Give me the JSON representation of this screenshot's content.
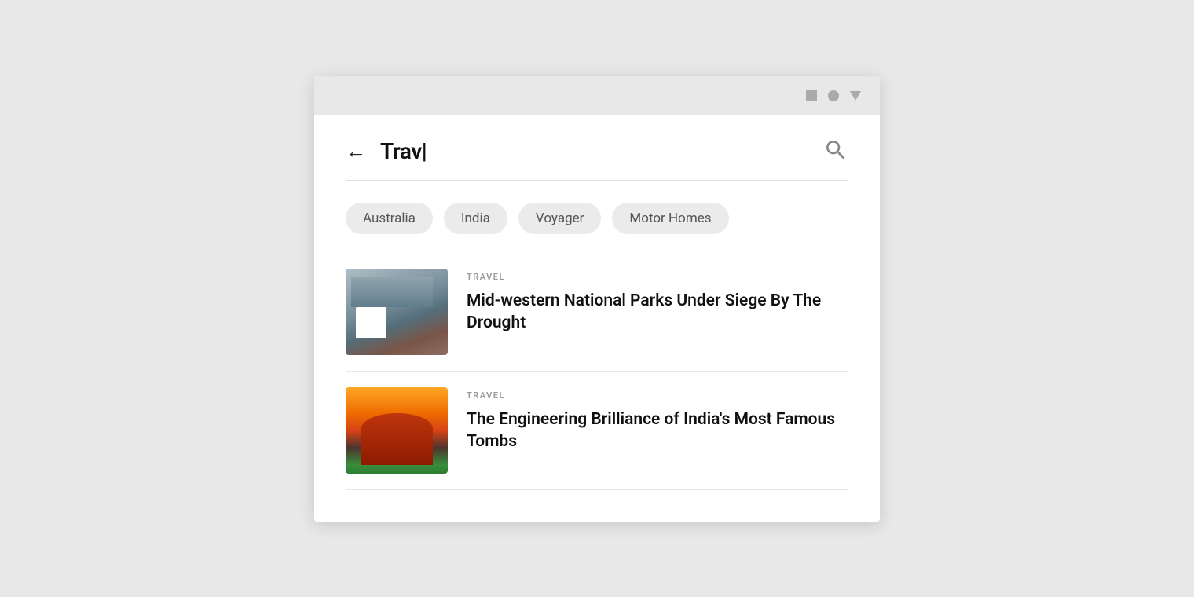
{
  "titlebar": {
    "icons": [
      "square",
      "circle",
      "triangle"
    ]
  },
  "search": {
    "back_label": "←",
    "query": "Trav|",
    "search_aria": "Search"
  },
  "tags": [
    {
      "label": "Australia",
      "id": "tag-australia"
    },
    {
      "label": "India",
      "id": "tag-india"
    },
    {
      "label": "Voyager",
      "id": "tag-voyager"
    },
    {
      "label": "Motor Homes",
      "id": "tag-motor-homes"
    }
  ],
  "articles": [
    {
      "id": "article-1",
      "category": "TRAVEL",
      "title": "Mid-western National Parks Under Siege By The Drought",
      "thumbnail_type": "landscape"
    },
    {
      "id": "article-2",
      "category": "TRAVEL",
      "title": "The Engineering Brilliance of India's Most Famous Tombs",
      "thumbnail_type": "india"
    }
  ]
}
